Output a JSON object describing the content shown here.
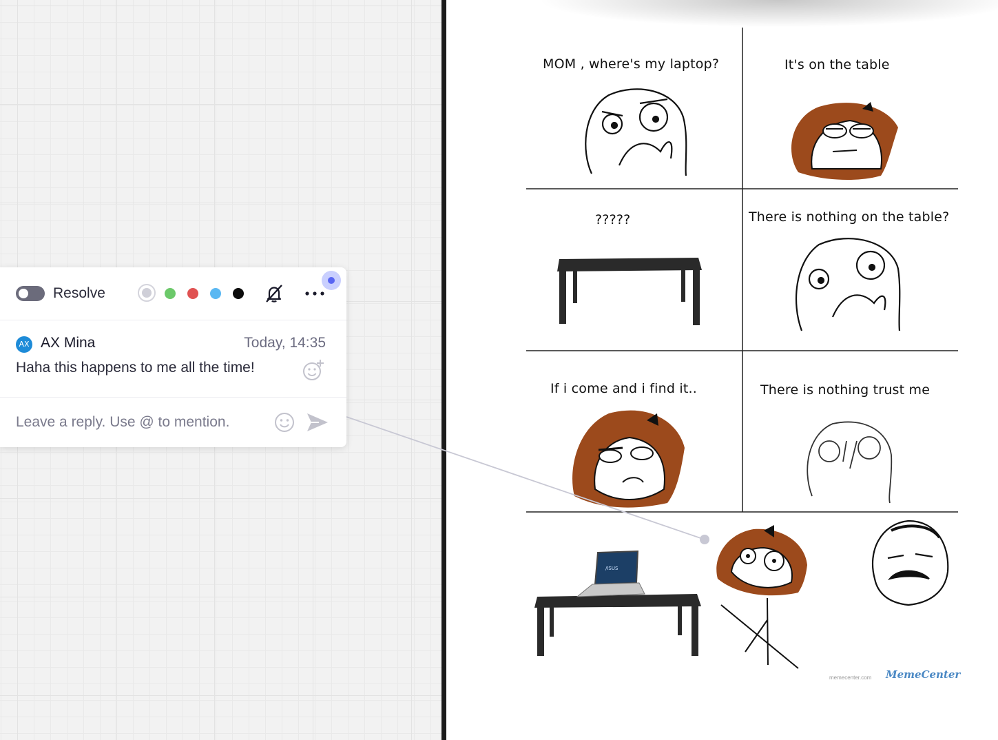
{
  "comment": {
    "resolve_label": "Resolve",
    "colors": [
      "#cfcfd8",
      "#6cc96a",
      "#e05252",
      "#5bb8f2",
      "#0c0c0c"
    ],
    "author_initials": "AX",
    "author_name": "AX Mina",
    "timestamp": "Today, 14:35",
    "message": "Haha this happens to me all the time!",
    "reply_placeholder": "Leave a reply. Use @ to mention."
  },
  "comic": {
    "captions": [
      "MOM , where's my laptop?",
      "It's on the table",
      "?????",
      "There is nothing on the table?",
      "If i come and i find it..",
      "There is nothing trust me"
    ],
    "laptop_brand": "/ISUS",
    "watermark_site": "memecenter.com",
    "watermark_logo": "MemeCenter"
  }
}
